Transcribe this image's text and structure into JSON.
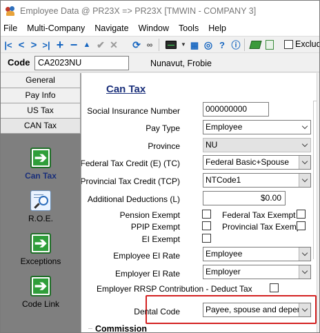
{
  "window": {
    "title": "Employee Data @ PR23X => PR23X [TMWIN - COMPANY 3]"
  },
  "menu": [
    "File",
    "Multi-Company",
    "Navigate",
    "Window",
    "Tools",
    "Help"
  ],
  "toolbar": {
    "exclude_label": "Exclude",
    "exclude_checked": false
  },
  "employee": {
    "code_label": "Code",
    "code_value": "CA2023NU",
    "name": "Nunavut,  Frobie"
  },
  "tabs": [
    "General",
    "Pay Info",
    "US Tax",
    "CAN Tax"
  ],
  "active_tab": "CAN Tax",
  "nav": [
    {
      "label": "Can Tax",
      "icon": "green-arrow-icon",
      "selected": true
    },
    {
      "label": "R.O.E.",
      "icon": "magnifier-document-icon",
      "selected": false
    },
    {
      "label": "Exceptions",
      "icon": "green-arrow-icon",
      "selected": false
    },
    {
      "label": "Code Link",
      "icon": "green-arrow-icon",
      "selected": false
    }
  ],
  "form": {
    "title": "Can Tax",
    "sin": {
      "label": "Social Insurance Number",
      "value": "000000000"
    },
    "pay_type": {
      "label": "Pay Type",
      "value": "Employee"
    },
    "province": {
      "label": "Province",
      "value": "NU"
    },
    "federal_tc": {
      "label": "Federal Tax Credit (E) (TC)",
      "value": "Federal Basic+Spouse"
    },
    "provincial_tcp": {
      "label": "Provincial Tax Credit (TCP)",
      "value": "NTCode1"
    },
    "additional_deductions": {
      "label": "Additional Deductions (L)",
      "value": "$0.00"
    },
    "pension_exempt": {
      "label": "Pension Exempt",
      "checked": false
    },
    "ppip_exempt": {
      "label": "PPIP Exempt",
      "checked": false
    },
    "ei_exempt": {
      "label": "EI Exempt",
      "checked": false
    },
    "federal_tax_exempt": {
      "label": "Federal Tax Exempt",
      "checked": false
    },
    "provincial_tax_exempt": {
      "label": "Provincial Tax Exempt",
      "checked": false
    },
    "employee_ei_rate": {
      "label": "Employee EI Rate",
      "value": "Employee"
    },
    "employer_ei_rate": {
      "label": "Employer EI Rate",
      "value": "Employer"
    },
    "rrsp": {
      "label": "Employer RRSP Contribution - Deduct Tax",
      "checked": false
    },
    "dental_code": {
      "label": "Dental Code",
      "value": "Payee, spouse and dependents"
    },
    "commission_heading": "Commission"
  },
  "colors": {
    "accent": "#1a2f7a",
    "highlight": "#d32020",
    "nav_green": "#2f9e3a",
    "sidebar": "#7f7f7f"
  }
}
